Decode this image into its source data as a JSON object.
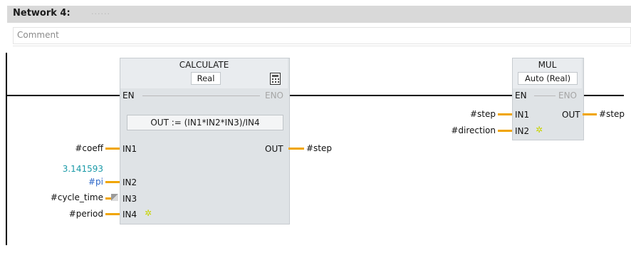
{
  "network": {
    "title": "Network 4:",
    "dots": "......",
    "comment": "Comment"
  },
  "calculate": {
    "title": "CALCULATE",
    "type": "Real",
    "en": "EN",
    "eno": "ENO",
    "expression": "OUT :=  (IN1*IN2*IN3)/IN4",
    "out": "OUT",
    "inputs": [
      "IN1",
      "IN2",
      "IN3",
      "IN4"
    ],
    "params": {
      "in1": "#coeff",
      "in2_const": "3.141593",
      "in2": "#pi",
      "in3": "#cycle_time",
      "in4": "#period",
      "out": "#step"
    },
    "add_input_icon": "sparkle-icon"
  },
  "mul": {
    "title": "MUL",
    "type": "Auto (Real)",
    "en": "EN",
    "eno": "ENO",
    "in1_label": "IN1",
    "in2_label": "IN2",
    "out_label": "OUT",
    "params": {
      "in1": "#step",
      "in2": "#direction",
      "out": "#step"
    },
    "add_input_icon": "sparkle-icon"
  },
  "colors": {
    "wire": "#f0a500",
    "block": "#dfe3e6",
    "constant": "#1a9aa8",
    "variable_blue": "#2b66c8"
  }
}
